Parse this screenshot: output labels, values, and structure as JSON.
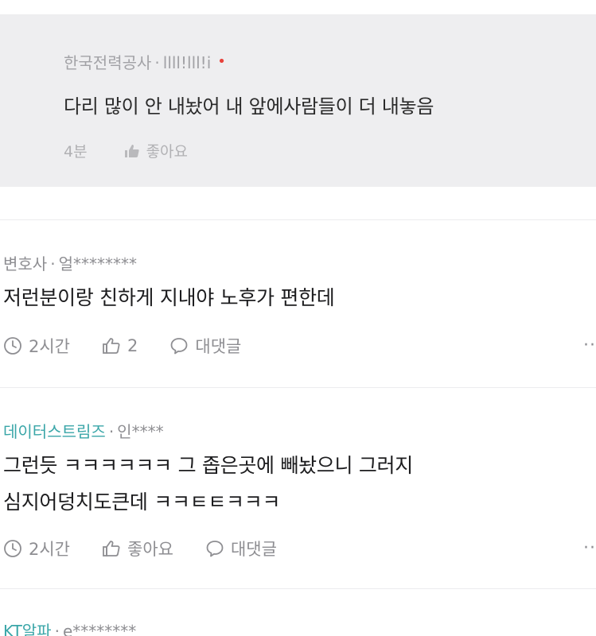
{
  "reply": {
    "author": "한국전력공사",
    "separator": "·",
    "user_id": "llll!lll!i",
    "marker": "•",
    "text": "다리 많이 안 내놨어 내 앞에사람들이 더 내놓음",
    "time": "4분",
    "like_label": "좋아요"
  },
  "comments": [
    {
      "author": "변호사",
      "separator": "·",
      "user_id": "얼********",
      "lines": [
        "저런분이랑 친하게 지내야 노후가 편한데"
      ],
      "time": "2시간",
      "likes": "2",
      "reply_label": "대댓글",
      "more": "··"
    },
    {
      "author": "데이터스트림즈",
      "author_color": "#3aa6a8",
      "separator": "·",
      "user_id": "인****",
      "lines": [
        "그런듯 ㅋㅋㅋㅋㅋㅋ 그 좁은곳에 빼놨으니 그러지",
        "심지어덩치도큰데 ㅋㅋㅌㅌㅋㅋㅋ"
      ],
      "time": "2시간",
      "likes": "좋아요",
      "reply_label": "대댓글",
      "more": "··"
    },
    {
      "author": "KT알파",
      "author_color": "#3aa6a8",
      "separator": "·",
      "user_id": "e********"
    }
  ],
  "icons": {
    "like": "thumbs-up-icon",
    "time": "clock-icon",
    "reply": "speech-bubble-icon",
    "more": "more-dots-icon"
  },
  "colors": {
    "reply_background": "#eeeef0",
    "marker_red": "#e8423b",
    "company_teal": "#3aa6a8",
    "meta_gray": "#8e8e92"
  }
}
